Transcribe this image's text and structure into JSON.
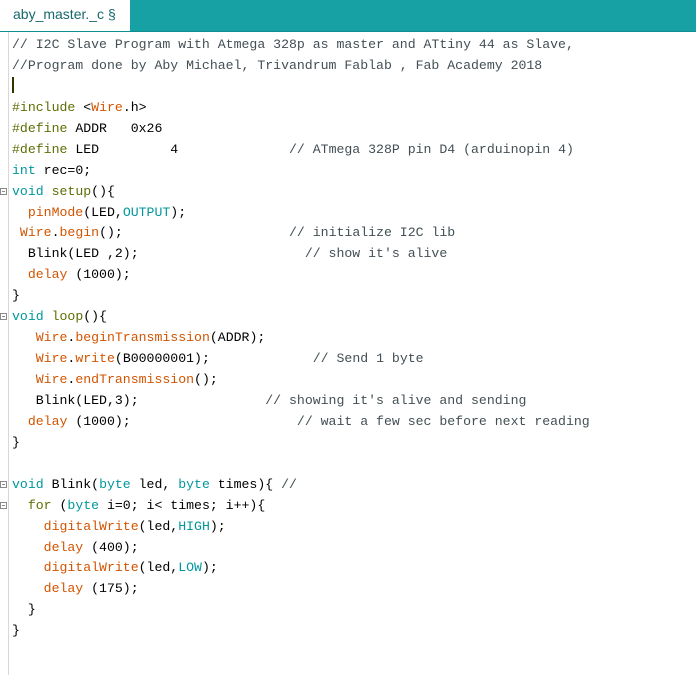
{
  "tab": {
    "label": "aby_master._c §"
  },
  "colors": {
    "tab_bar_bg": "#17a1a5",
    "tab_text": "#17686b",
    "comment": "#434f54",
    "preprocessor": "#5e6d03",
    "keyword": "#00979c",
    "function": "#d35400"
  },
  "code": {
    "lines": [
      [
        {
          "t": "// I2C Slave Program with Atmega 328p as master and ATtiny 44 as Slave,",
          "c": "comment"
        }
      ],
      [
        {
          "t": "//Program done by Aby Michael, Trivandrum Fablab , Fab Academy 2018",
          "c": "comment"
        }
      ],
      [
        {
          "t": "",
          "c": "cursor"
        }
      ],
      [
        {
          "t": "#include ",
          "c": "pre"
        },
        {
          "t": "<",
          "c": "id"
        },
        {
          "t": "Wire",
          "c": "fn"
        },
        {
          "t": ".h>",
          "c": "id"
        }
      ],
      [
        {
          "t": "#define ",
          "c": "pre"
        },
        {
          "t": "ADDR   0x26",
          "c": "id"
        }
      ],
      [
        {
          "t": "#define ",
          "c": "pre"
        },
        {
          "t": "LED         4              ",
          "c": "id"
        },
        {
          "t": "// ATmega 328P pin D4 (arduinopin 4)",
          "c": "comment"
        }
      ],
      [
        {
          "t": "int",
          "c": "kw"
        },
        {
          "t": " rec=0;",
          "c": "id"
        }
      ],
      [
        {
          "t": "void",
          "c": "kw"
        },
        {
          "t": " ",
          "c": "id"
        },
        {
          "t": "setup",
          "c": "pre"
        },
        {
          "t": "(){",
          "c": "id"
        }
      ],
      [
        {
          "t": "  ",
          "c": "id"
        },
        {
          "t": "pinMode",
          "c": "fn"
        },
        {
          "t": "(LED,",
          "c": "id"
        },
        {
          "t": "OUTPUT",
          "c": "const"
        },
        {
          "t": ");",
          "c": "id"
        }
      ],
      [
        {
          "t": " ",
          "c": "id"
        },
        {
          "t": "Wire",
          "c": "fn"
        },
        {
          "t": ".",
          "c": "id"
        },
        {
          "t": "begin",
          "c": "fn"
        },
        {
          "t": "();                     ",
          "c": "id"
        },
        {
          "t": "// initialize I2C lib",
          "c": "comment"
        }
      ],
      [
        {
          "t": "  Blink(LED ,2);                     ",
          "c": "id"
        },
        {
          "t": "// show it's alive",
          "c": "comment"
        }
      ],
      [
        {
          "t": "  ",
          "c": "id"
        },
        {
          "t": "delay",
          "c": "fn"
        },
        {
          "t": " (1000);",
          "c": "id"
        }
      ],
      [
        {
          "t": "}",
          "c": "id"
        }
      ],
      [
        {
          "t": "void",
          "c": "kw"
        },
        {
          "t": " ",
          "c": "id"
        },
        {
          "t": "loop",
          "c": "pre"
        },
        {
          "t": "(){",
          "c": "id"
        }
      ],
      [
        {
          "t": "   ",
          "c": "id"
        },
        {
          "t": "Wire",
          "c": "fn"
        },
        {
          "t": ".",
          "c": "id"
        },
        {
          "t": "beginTransmission",
          "c": "fn"
        },
        {
          "t": "(ADDR);",
          "c": "id"
        }
      ],
      [
        {
          "t": "   ",
          "c": "id"
        },
        {
          "t": "Wire",
          "c": "fn"
        },
        {
          "t": ".",
          "c": "id"
        },
        {
          "t": "write",
          "c": "fn"
        },
        {
          "t": "(B00000001);             ",
          "c": "id"
        },
        {
          "t": "// Send 1 byte",
          "c": "comment"
        }
      ],
      [
        {
          "t": "   ",
          "c": "id"
        },
        {
          "t": "Wire",
          "c": "fn"
        },
        {
          "t": ".",
          "c": "id"
        },
        {
          "t": "endTransmission",
          "c": "fn"
        },
        {
          "t": "();",
          "c": "id"
        }
      ],
      [
        {
          "t": "   Blink(LED,3);                ",
          "c": "id"
        },
        {
          "t": "// showing it's alive and sending",
          "c": "comment"
        }
      ],
      [
        {
          "t": "  ",
          "c": "id"
        },
        {
          "t": "delay",
          "c": "fn"
        },
        {
          "t": " (1000);                     ",
          "c": "id"
        },
        {
          "t": "// wait a few sec before next reading",
          "c": "comment"
        }
      ],
      [
        {
          "t": "}",
          "c": "id"
        }
      ],
      [
        {
          "t": "",
          "c": "id"
        }
      ],
      [
        {
          "t": "void",
          "c": "kw"
        },
        {
          "t": " Blink(",
          "c": "id"
        },
        {
          "t": "byte",
          "c": "kw"
        },
        {
          "t": " led, ",
          "c": "id"
        },
        {
          "t": "byte",
          "c": "kw"
        },
        {
          "t": " times){ ",
          "c": "id"
        },
        {
          "t": "//",
          "c": "comment"
        }
      ],
      [
        {
          "t": "  ",
          "c": "id"
        },
        {
          "t": "for",
          "c": "pre"
        },
        {
          "t": " (",
          "c": "id"
        },
        {
          "t": "byte",
          "c": "kw"
        },
        {
          "t": " i=0; i< times; i++){",
          "c": "id"
        }
      ],
      [
        {
          "t": "    ",
          "c": "id"
        },
        {
          "t": "digitalWrite",
          "c": "fn"
        },
        {
          "t": "(led,",
          "c": "id"
        },
        {
          "t": "HIGH",
          "c": "const"
        },
        {
          "t": ");",
          "c": "id"
        }
      ],
      [
        {
          "t": "    ",
          "c": "id"
        },
        {
          "t": "delay",
          "c": "fn"
        },
        {
          "t": " (400);",
          "c": "id"
        }
      ],
      [
        {
          "t": "    ",
          "c": "id"
        },
        {
          "t": "digitalWrite",
          "c": "fn"
        },
        {
          "t": "(led,",
          "c": "id"
        },
        {
          "t": "LOW",
          "c": "const"
        },
        {
          "t": ");",
          "c": "id"
        }
      ],
      [
        {
          "t": "    ",
          "c": "id"
        },
        {
          "t": "delay",
          "c": "fn"
        },
        {
          "t": " (175);",
          "c": "id"
        }
      ],
      [
        {
          "t": "  }",
          "c": "id"
        }
      ],
      [
        {
          "t": "}",
          "c": "id"
        }
      ]
    ],
    "fold_markers_at_lines": [
      7,
      13,
      21,
      22
    ]
  }
}
